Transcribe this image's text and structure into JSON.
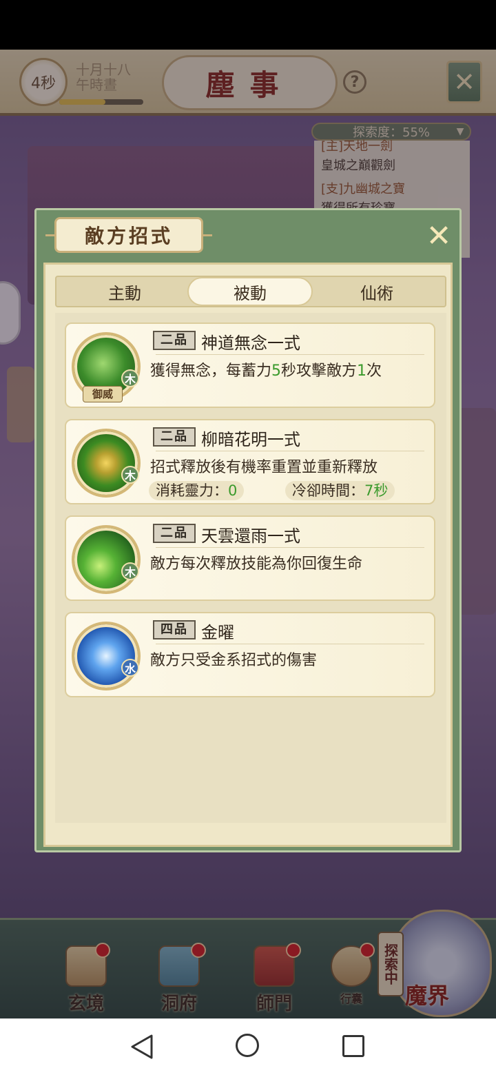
{
  "top": {
    "timer": "4秒",
    "date_line1": "十月十八",
    "date_line2": "午時晝",
    "date_progress": 0.55,
    "title": "塵事",
    "help": "?"
  },
  "explore": {
    "label": "探索度：55%",
    "quests": [
      {
        "text": "[主]天地一劍",
        "color": "#9b5a28"
      },
      {
        "text": "皇城之巔觀劍",
        "color": "#4a3c2a"
      },
      {
        "text": "[支]九幽城之寶",
        "color": "#9b5a28"
      },
      {
        "text": "獲得所有珍寶",
        "color": "#4a3c2a"
      }
    ]
  },
  "modal": {
    "title": "敵方招式",
    "tabs": [
      {
        "label": "主動",
        "active": false
      },
      {
        "label": "被動",
        "active": true
      },
      {
        "label": "仙術",
        "active": false
      }
    ],
    "skills": [
      {
        "grade": "二品",
        "name": "神道無念一式",
        "desc_parts": [
          "獲得無念，每蓄力",
          "5",
          "秒攻擊敵方",
          "1",
          "次"
        ],
        "element": "木",
        "tag": "御威",
        "icon": "green-warrior-icon"
      },
      {
        "grade": "二品",
        "name": "柳暗花明一式",
        "desc": "招式釋放後有機率重置並重新釋放",
        "element": "木",
        "icon": "golden-lotus-icon",
        "stats": [
          {
            "label": "消耗靈力：",
            "value": "0"
          },
          {
            "label": "冷卻時間：",
            "value": "7秒"
          }
        ]
      },
      {
        "grade": "二品",
        "name": "天雲還雨一式",
        "desc": "敵方每次釋放技能為你回復生命",
        "element": "木",
        "icon": "green-droplet-icon"
      },
      {
        "grade": "四品",
        "name": "金曜",
        "desc": "敵方只受金系招式的傷害",
        "element": "水",
        "icon": "blue-sword-icon"
      }
    ]
  },
  "bottom_nav": {
    "items": [
      "玄境",
      "洞府",
      "師門",
      "行囊"
    ],
    "explore_tag": "探索中",
    "mojie": "魔界"
  },
  "colors": {
    "accent_green": "#3a9a2c",
    "wood_badge": "#5e8a58",
    "water_badge": "#3d6fb5"
  }
}
